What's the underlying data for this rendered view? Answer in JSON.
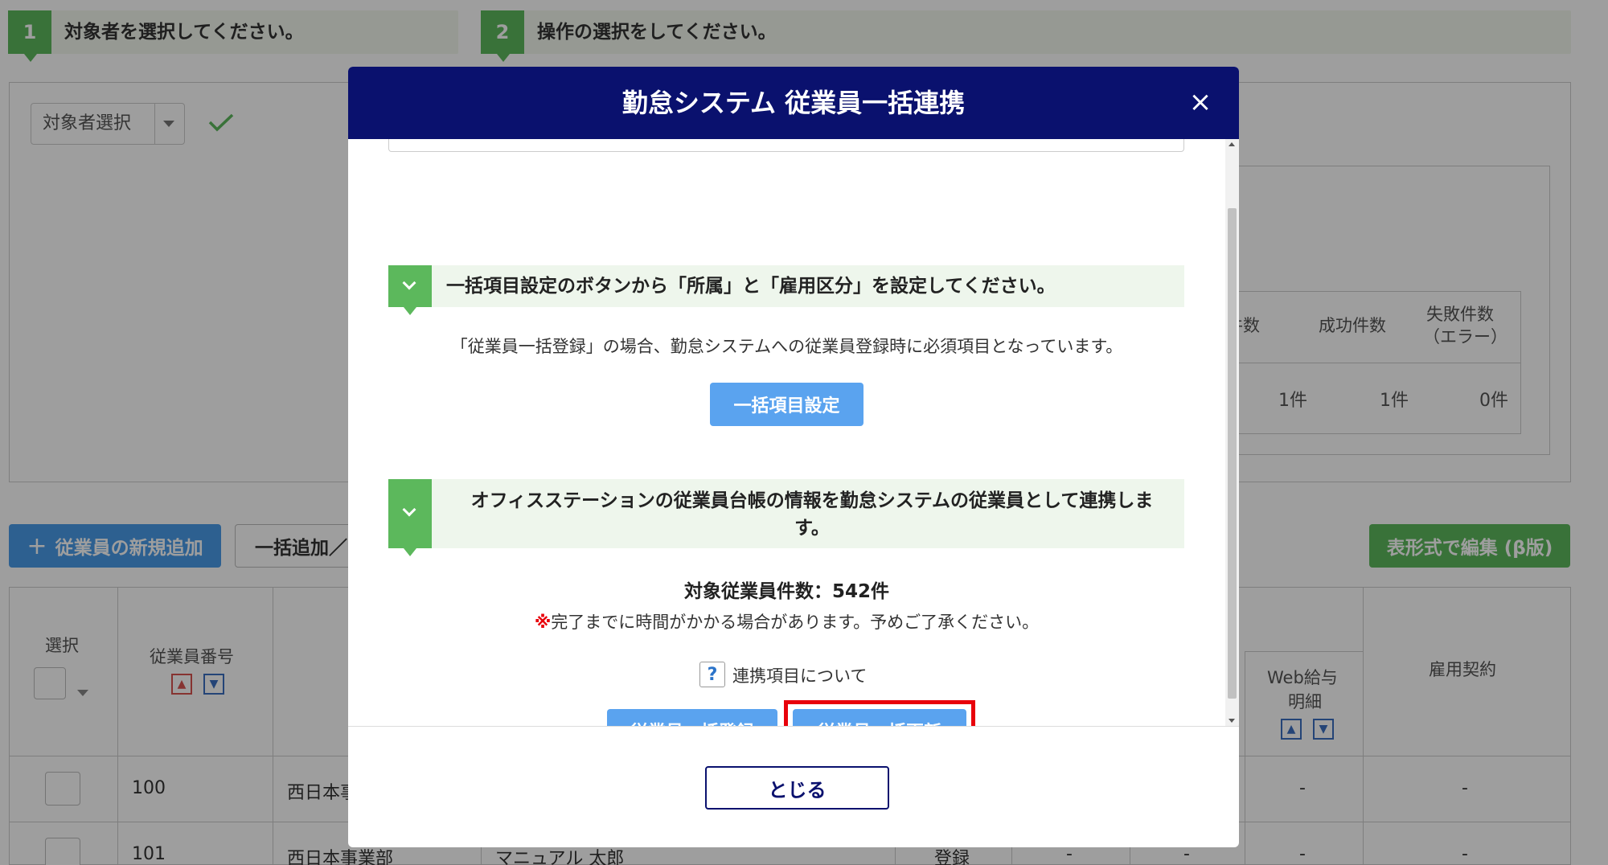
{
  "steps": [
    {
      "num": "1",
      "label": "対象者を選択してください。"
    },
    {
      "num": "2",
      "label": "操作の選択をしてください。"
    }
  ],
  "target_select": {
    "label": "対象者選択"
  },
  "results_table": {
    "headers": [
      "件数",
      "成功件数",
      "失敗件数\n（エラー）"
    ],
    "header_fail_line1": "失敗件数",
    "header_fail_line2": "（エラー）",
    "values": [
      "1件",
      "1件",
      "0件"
    ]
  },
  "toolbar": {
    "add_employee": "従業員の新規追加",
    "bulk_add": "一括追加／",
    "table_edit": "表形式で編集 (β版)"
  },
  "employee_table": {
    "header_select": "選択",
    "header_number": "従業員番号",
    "header_web_pay_line1": "Web給与",
    "header_web_pay_line2": "明細",
    "header_contract": "雇用契約",
    "rows": [
      {
        "number": "100",
        "dept": "西日本事",
        "status": "",
        "web": "-",
        "contract": "-"
      },
      {
        "number": "101",
        "dept": "西日本事業部",
        "name": "マニュアル 太郎",
        "status": "登録",
        "c1": "-",
        "c2": "-",
        "web": "-",
        "contract": "-"
      }
    ]
  },
  "modal": {
    "title": "勤怠システム 従業員一括連携",
    "close_icon": "×",
    "section1": {
      "heading": "一括項目設定のボタンから「所属」と「雇用区分」を設定してください。",
      "description": "「従業員一括登録」の場合、勤怠システムへの従業員登録時に必須項目となっています。",
      "button": "一括項目設定"
    },
    "section2": {
      "heading_line1": "オフィスステーションの従業員台帳の情報を勤怠システムの従業員として連携しま",
      "heading_line2": "す。",
      "count_text": "対象従業員件数：542件",
      "note_mark": "※",
      "note_text": "完了までに時間がかかる場合があります。予めご了承ください。",
      "help_text": "連携項目について",
      "register_button": "従業員一括登録",
      "update_button": "従業員一括更新"
    },
    "footer_close": "とじる"
  },
  "colors": {
    "header_navy": "#0a116e",
    "primary_blue": "#5aa3ef",
    "step_green": "#5cb85c",
    "highlight_red": "#e8000b"
  }
}
